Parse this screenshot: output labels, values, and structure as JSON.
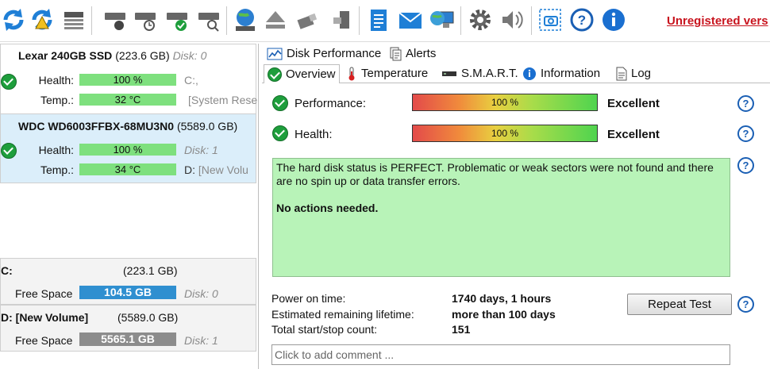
{
  "toolbar": {
    "icons": [
      "refresh-icon",
      "refresh-warning-icon",
      "disk-list-icon",
      "disk-stethoscope-icon",
      "disk-clock-icon",
      "disk-check-icon",
      "disk-search-icon",
      "globe-disk-icon",
      "eject-icon",
      "usb-drive-icon",
      "usb-drive-alt-icon",
      "notes-icon",
      "email-icon",
      "computer-globe-icon",
      "gear-icon",
      "speaker-icon",
      "screenshot-camera-icon",
      "help-icon",
      "info-icon"
    ],
    "unregistered": "Unregistered vers"
  },
  "disks": [
    {
      "name": "Lexar 240GB SSD",
      "size": "(223.6 GB)",
      "disk": "Disk: 0",
      "health_label": "Health:",
      "health": "100 %",
      "health_value": 100,
      "drive": "C:,",
      "temp_label": "Temp.:",
      "temp": "32 °C",
      "volume": "[System Rese"
    },
    {
      "name": "WDC WD6003FFBX-68MU3N0",
      "size": "(5589.0 GB)",
      "disk": "Disk: 1",
      "health_label": "Health:",
      "health": "100 %",
      "health_value": 100,
      "drive": "D:",
      "temp_label": "Temp.:",
      "temp": "34 °C",
      "volume": "[New Volu"
    }
  ],
  "volumes": [
    {
      "name": "C:",
      "size": "(223.1 GB)",
      "free_label": "Free Space",
      "free": "104.5 GB",
      "disk": "Disk: 0",
      "color": "#2f8fd0"
    },
    {
      "name": "D: [New Volume]",
      "size": "(5589.0 GB)",
      "free_label": "Free Space",
      "free": "5565.1 GB",
      "disk": "Disk: 1",
      "color": "#8c8c8c"
    }
  ],
  "tabs_row1": [
    {
      "label": "Disk Performance",
      "icon": "performance-chart-icon"
    },
    {
      "label": "Alerts",
      "icon": "alerts-doc-icon"
    }
  ],
  "tabs_row2": [
    {
      "label": "Overview",
      "icon": "check-icon",
      "active": true
    },
    {
      "label": "Temperature",
      "icon": "thermometer-icon"
    },
    {
      "label": "S.M.A.R.T.",
      "icon": "smart-chip-icon"
    },
    {
      "label": "Information",
      "icon": "info-icon"
    },
    {
      "label": "Log",
      "icon": "log-doc-icon"
    }
  ],
  "overview": {
    "performance_label": "Performance:",
    "performance_value": "100 %",
    "performance_level": 100,
    "performance_rating": "Excellent",
    "health_label": "Health:",
    "health_value": "100 %",
    "health_level": 100,
    "health_rating": "Excellent",
    "message": "The hard disk status is PERFECT. Problematic or weak sectors were not found and there are no spin up or data transfer errors.",
    "message_bold": "No actions needed.",
    "power_on_label": "Power on time:",
    "power_on_value": "1740 days, 1 hours",
    "lifetime_label": "Estimated remaining lifetime:",
    "lifetime_value": "more than 100 days",
    "startstop_label": "Total start/stop count:",
    "startstop_value": "151",
    "repeat_test": "Repeat Test",
    "comment_placeholder": "Click to add comment ..."
  },
  "help_mark": "?",
  "colors": {
    "health_bar": "#7ee07e",
    "message_bg": "#b8f3b8",
    "selected_disk": "#dbeefa",
    "unregistered": "#c8141e"
  }
}
